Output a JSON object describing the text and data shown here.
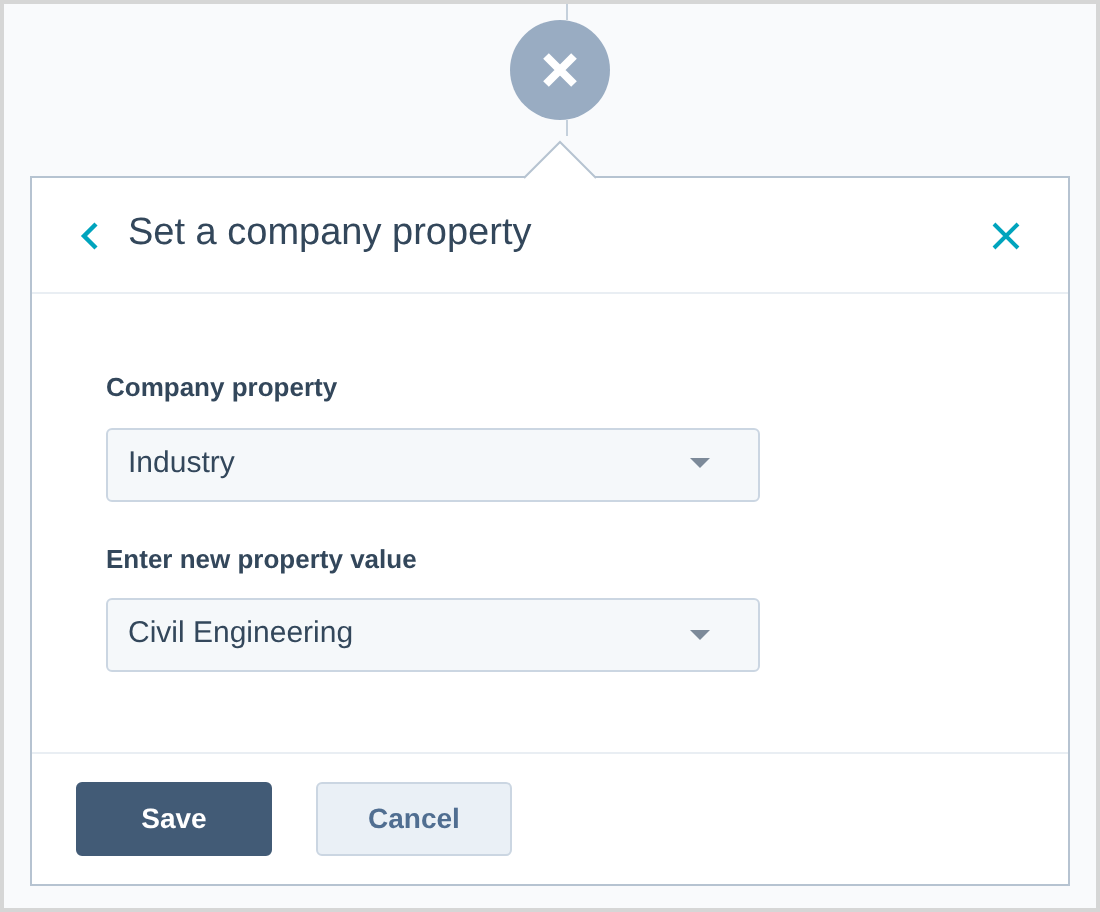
{
  "panel": {
    "title": "Set a company property"
  },
  "fields": [
    {
      "label": "Company property",
      "value": "Industry"
    },
    {
      "label": "Enter new property value",
      "value": "Civil Engineering"
    }
  ],
  "buttons": [
    {
      "label": "Save",
      "kind": "primary"
    },
    {
      "label": "Cancel",
      "kind": "secondary"
    }
  ]
}
